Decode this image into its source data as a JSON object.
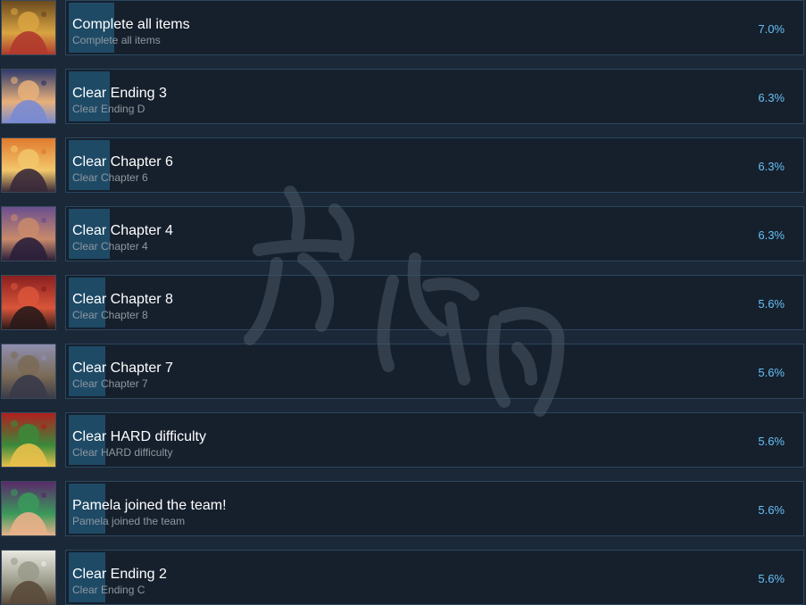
{
  "achievements": [
    {
      "title": "Complete all items",
      "description": "Complete all items",
      "percent": "7.0%",
      "progress_fraction": 0.07,
      "icon": "treasure-pile-icon",
      "icon_colors": [
        "#6b4a1f",
        "#d9a441",
        "#b03a2e"
      ]
    },
    {
      "title": "Clear Ending 3",
      "description": "Clear Ending D",
      "percent": "6.3%",
      "progress_fraction": 0.063,
      "icon": "witch-girl-portrait-icon",
      "icon_colors": [
        "#2e3a6b",
        "#e8b07a",
        "#7a8bd1"
      ]
    },
    {
      "title": "Clear Chapter 6",
      "description": "Clear Chapter 6",
      "percent": "6.3%",
      "progress_fraction": 0.063,
      "icon": "sunset-castle-icon",
      "icon_colors": [
        "#e07a2e",
        "#f2c76b",
        "#3a2a3a"
      ]
    },
    {
      "title": "Clear Chapter 4",
      "description": "Clear Chapter 4",
      "percent": "6.3%",
      "progress_fraction": 0.063,
      "icon": "graveyard-crosses-icon",
      "icon_colors": [
        "#6a4f8f",
        "#c98a6b",
        "#2a1f3a"
      ]
    },
    {
      "title": "Clear Chapter 8",
      "description": "Clear Chapter 8",
      "percent": "5.6%",
      "progress_fraction": 0.056,
      "icon": "red-castle-icon",
      "icon_colors": [
        "#8a1f1f",
        "#d9553a",
        "#2a1a1a"
      ]
    },
    {
      "title": "Clear Chapter 7",
      "description": "Clear Chapter 7",
      "percent": "5.6%",
      "progress_fraction": 0.056,
      "icon": "rocky-mountains-icon",
      "icon_colors": [
        "#8f8fb0",
        "#7a6a55",
        "#3a3a4a"
      ]
    },
    {
      "title": "Clear HARD difficulty",
      "description": "Clear HARD difficulty",
      "percent": "5.6%",
      "progress_fraction": 0.056,
      "icon": "armored-demon-icon",
      "icon_colors": [
        "#b0201f",
        "#3a8a3a",
        "#e8c04a"
      ]
    },
    {
      "title": "Pamela joined the team!",
      "description": "Pamela joined the team",
      "percent": "5.6%",
      "progress_fraction": 0.056,
      "icon": "pamela-portrait-icon",
      "icon_colors": [
        "#5a2a6b",
        "#3a9a5a",
        "#e8b08a"
      ]
    },
    {
      "title": "Clear Ending 2",
      "description": "Clear Ending C",
      "percent": "5.6%",
      "progress_fraction": 0.056,
      "icon": "white-haired-girl-icon",
      "icon_colors": [
        "#e8e8e0",
        "#9a9a8a",
        "#5a4a3a"
      ]
    }
  ],
  "colors": {
    "background": "#1b2838",
    "bar_background": "#16202d",
    "bar_border": "#2a475e",
    "progress_fill": "#1e4a66",
    "title": "#ffffff",
    "description": "#8f98a0",
    "percent": "#66c0f4"
  }
}
